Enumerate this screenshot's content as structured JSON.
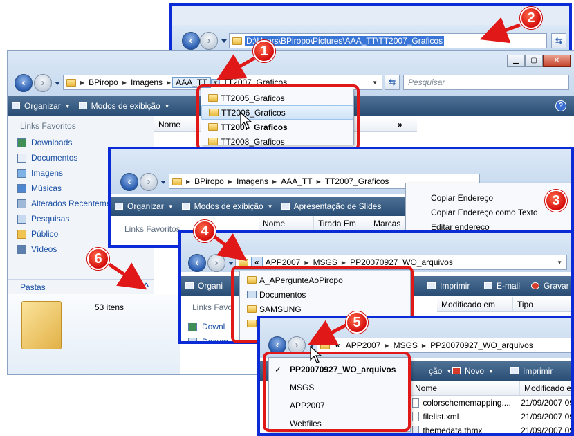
{
  "search_placeholder": "Pesquisar",
  "win2": {
    "address_path": "D:\\Users\\BPiropo\\Pictures\\AAA_TT\\TT2007_Graficos"
  },
  "win1": {
    "breadcrumbs": [
      "BPiropo",
      "Imagens",
      "AAA_TT",
      "TT2007_Graficos"
    ],
    "toolbar": {
      "organize": "Organizar",
      "views": "Modos de exibição"
    },
    "favorites_title": "Links Favoritos",
    "favorites": [
      "Downloads",
      "Documentos",
      "Imagens",
      "Músicas",
      "Alterados Recentemente",
      "Pesquisas",
      "Público",
      "Vídeos"
    ],
    "folders_label": "Pastas",
    "item_count": "53 itens",
    "col_name": "Nome",
    "more_cols": "»",
    "dropdown": [
      "TT2005_Graficos",
      "TT2006_Graficos",
      "TT2007_Graficos",
      "TT2008_Graficos"
    ],
    "dropdown_selected_index": 2
  },
  "win3": {
    "breadcrumbs": [
      "BPiropo",
      "Imagens",
      "AAA_TT",
      "TT2007_Graficos"
    ],
    "toolbar": {
      "organize": "Organizar",
      "views": "Modos de exibição",
      "slideshow": "Apresentação de Slides"
    },
    "favorites_title": "Links Favoritos",
    "columns": [
      "Nome",
      "Tirada Em",
      "Marcas"
    ],
    "context_menu": [
      "Copiar Endereço",
      "Copiar Endereço como Texto",
      "Editar endereço"
    ]
  },
  "win4": {
    "chevron": "«",
    "breadcrumbs": [
      "APP2007",
      "MSGS",
      "PP20070927_WO_arquivos"
    ],
    "toolbar": {
      "organize": "Organi",
      "print": "Imprimir",
      "email": "E-mail",
      "burn": "Gravar"
    },
    "favorites_title": "Links Favo",
    "favorites_partial": [
      "Downl",
      "Docum"
    ],
    "columns": [
      "Modificado em",
      "Tipo"
    ],
    "dropdown": [
      "A_APergunteAoPiropo",
      "Documentos",
      "SAMSUNG",
      "",
      ""
    ]
  },
  "win5": {
    "chevron": "«",
    "breadcrumbs": [
      "APP2007",
      "MSGS",
      "PP20070927_WO_arquivos"
    ],
    "toolbar": {
      "share": "ção",
      "new": "Novo",
      "print": "Imprimir"
    },
    "columns": [
      "Nome",
      "Modificado e"
    ],
    "files": [
      {
        "name": "colorschememapping....",
        "date": "21/09/2007 09"
      },
      {
        "name": "filelist.xml",
        "date": "21/09/2007 09"
      },
      {
        "name": "themedata.thmx",
        "date": "21/09/2007 09"
      }
    ],
    "history_menu": [
      "PP20070927_WO_arquivos",
      "MSGS",
      "APP2007",
      "Webfiles"
    ],
    "history_checked": "✓"
  },
  "callouts": [
    "1",
    "2",
    "3",
    "4",
    "5",
    "6"
  ],
  "colors": {
    "callout_red": "#e01818",
    "frame_blue": "#0a2bd6",
    "toolbar": "#294d74",
    "link": "#1a4fa3"
  }
}
